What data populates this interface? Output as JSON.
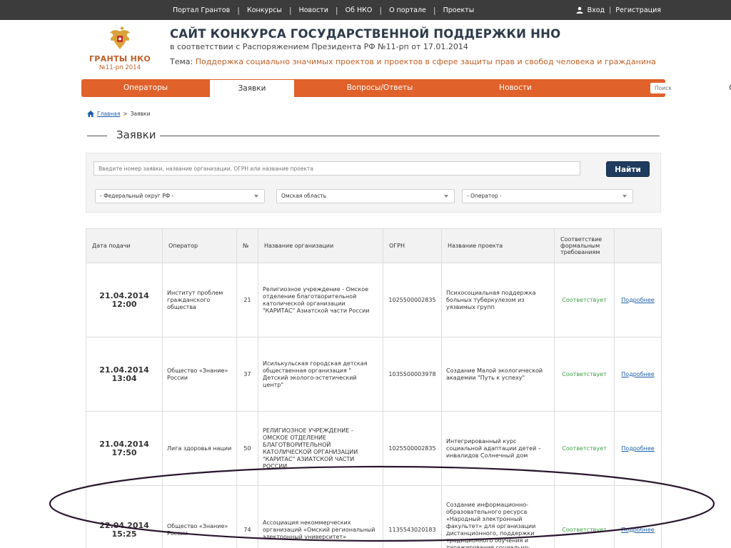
{
  "topnav": {
    "items": [
      "Портал Грантов",
      "Конкурсы",
      "Новости",
      "Об НКО",
      "О портале",
      "Проекты"
    ],
    "login": "Вход",
    "register": "Регистрация"
  },
  "header": {
    "logo_title": "ГРАНТЫ НКО",
    "logo_sub": "№11-рп 2014",
    "title": "САЙТ КОНКУРСА ГОСУДАРСТВЕННОЙ ПОДДЕРЖКИ ННО",
    "subtitle": "в соответствии с Распоряжением Президента РФ №11-рп от 17.01.2014",
    "theme_label": "Тема:",
    "theme_value": "Поддержка социально значимых проектов и проектов в сфере защиты прав и свобод человека и гражданина"
  },
  "menu": {
    "items": [
      "Операторы",
      "Заявки",
      "Вопросы/Ответы",
      "Новости"
    ],
    "search_placeholder": "Поиск"
  },
  "breadcrumb": {
    "home": "Главная",
    "sep": ">",
    "current": "Заявки"
  },
  "page_title": "Заявки",
  "filters": {
    "query_placeholder": "Введите номер заявки, название организации, ОГРН или название проекта",
    "find_label": "Найти",
    "district": "- Федеральный округ РФ -",
    "region": "Омская область",
    "operator": "- Оператор -"
  },
  "table": {
    "headers": [
      "Дата подачи",
      "Оператор",
      "№",
      "Название организации",
      "ОГРН",
      "Название проекта",
      "Соответствие формальным требованиям",
      ""
    ],
    "rows": [
      {
        "date": "21.04.2014",
        "time": "12:00",
        "operator": "Институт проблем гражданского общества",
        "num": "21",
        "org": "Религиозное учреждение - Омское отделение благотворительной католической организации \"КАРИТАС\" Азиатской части России",
        "ogrn": "1025500002835",
        "project": "Психосоциальная поддержка больных туберкулезом из уязвимых групп",
        "status": "Соответствует",
        "more": "Подробнее"
      },
      {
        "date": "21.04.2014",
        "time": "13:04",
        "operator": "Общество «Знание» России",
        "num": "37",
        "org": "Исилькульская городская детская общественная организация \" Детский эколого-эстетический центр\"",
        "ogrn": "1035500003978",
        "project": "Создание Малой экологической академии \"Путь к успеху\"",
        "status": "Соответствует",
        "more": "Подробнее"
      },
      {
        "date": "21.04.2014",
        "time": "17:50",
        "operator": "Лига здоровья нации",
        "num": "50",
        "org": "РЕЛИГИОЗНОЕ УЧРЕЖДЕНИЕ - ОМСКОЕ ОТДЕЛЕНИЕ БЛАГОТВОРИТЕЛЬНОЙ КАТОЛИЧЕСКОЙ ОРГАНИЗАЦИИ \"КАРИТАС\" АЗИАТСКОЙ ЧАСТИ РОССИИ",
        "ogrn": "1025500002835",
        "project": "Интегрированный курс социальной адаптации детей – инвалидов Солнечный дом",
        "status": "Соответствует",
        "more": "Подробнее"
      },
      {
        "date": "22.04.2014",
        "time": "15:25",
        "operator": "Общество «Знание» России",
        "num": "74",
        "org": "Ассоциация некоммерческих организаций «Омский региональный электронный университет»",
        "ogrn": "1135543020183",
        "project": "Создание информационно-образовательного ресурса «Народный электронный факультет» для организации дистанционного, поддержки традиционного обучения и тиражирования социально-ориентированных практик",
        "status": "Соответствует",
        "more": "Подробнее"
      }
    ]
  },
  "colors": {
    "accent": "#e0612a",
    "topbar": "#3c3c3c",
    "button": "#1f3b5e",
    "ok": "#3da043",
    "link": "#1c5ea8"
  }
}
